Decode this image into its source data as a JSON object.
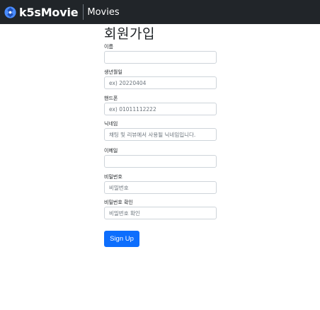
{
  "navbar": {
    "logo_icon": "film-reel-icon",
    "brand": "k5sMovie",
    "links": [
      "Movies"
    ],
    "background": "#212529"
  },
  "form": {
    "title": "회원가입",
    "fields": [
      {
        "label": "이름",
        "value": "",
        "placeholder": ""
      },
      {
        "label": "생년월일",
        "value": "",
        "placeholder": "ex) 20220404"
      },
      {
        "label": "핸드폰",
        "value": "",
        "placeholder": "ex) 01011112222"
      },
      {
        "label": "닉네임",
        "value": "",
        "placeholder": "채팅 및 리뷰에서 사용될 닉네임입니다."
      },
      {
        "label": "이메일",
        "value": "",
        "placeholder": ""
      },
      {
        "label": "비밀번호",
        "value": "",
        "placeholder": "비밀번호"
      },
      {
        "label": "비밀번호 확인",
        "value": "",
        "placeholder": "비밀번호 확인"
      }
    ],
    "submit_label": "Sign Up",
    "accent": "#0d6efd"
  }
}
